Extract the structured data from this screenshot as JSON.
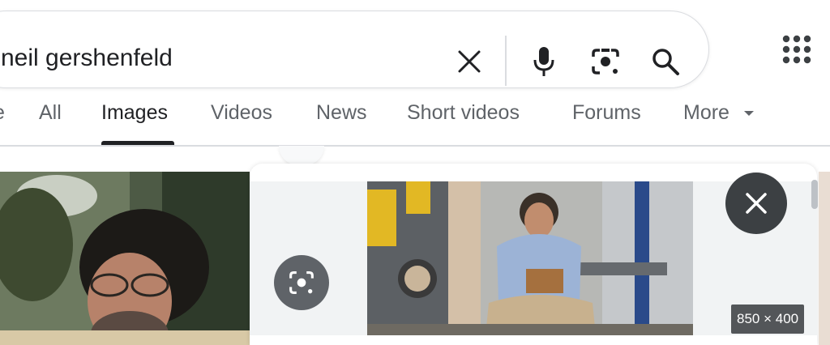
{
  "search": {
    "query": "neil gershenfeld"
  },
  "icons": {
    "clear": "close-icon",
    "voice": "microphone-icon",
    "lens": "camera-lens-icon",
    "search": "search-icon",
    "apps": "apps-grid-icon"
  },
  "tabs": [
    {
      "label": "e"
    },
    {
      "label": "All"
    },
    {
      "label": "Images",
      "active": true
    },
    {
      "label": "Videos"
    },
    {
      "label": "News"
    },
    {
      "label": "Short videos"
    },
    {
      "label": "Forums"
    },
    {
      "label": "More"
    }
  ],
  "preview": {
    "dimensions": "850 × 400"
  },
  "colors": {
    "text": "#202124",
    "muted": "#5f6368",
    "border": "#dadce0",
    "dark_button": "#3c4043"
  }
}
